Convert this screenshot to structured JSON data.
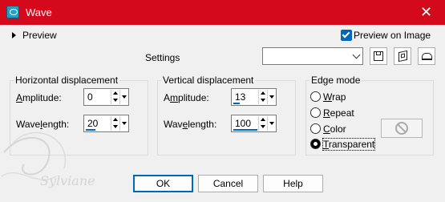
{
  "window": {
    "title": "Wave",
    "close_symbol": "✕"
  },
  "preview": {
    "toggle_label": "Preview",
    "on_image_label": "Preview on Image",
    "on_image_checked": true
  },
  "settings": {
    "label": "Settings",
    "selected": "",
    "buttons": [
      "save-preset-icon",
      "preset-library-icon",
      "reset-icon"
    ]
  },
  "horizontal": {
    "title": "Horizontal displacement",
    "amplitude_label_pre": "",
    "amplitude_label_u": "A",
    "amplitude_label_post": "mplitude:",
    "amplitude_value": "0",
    "wavelength_label_pre": "Wave",
    "wavelength_label_u": "l",
    "wavelength_label_post": "ength:",
    "wavelength_value": "20"
  },
  "vertical": {
    "title": "Vertical displacement",
    "amplitude_label_pre": "A",
    "amplitude_label_u": "m",
    "amplitude_label_post": "plitude:",
    "amplitude_value": "13",
    "wavelength_label_pre": "Wav",
    "wavelength_label_u": "e",
    "wavelength_label_post": "length:",
    "wavelength_value": "100"
  },
  "edge_mode": {
    "title": "Edge mode",
    "options": [
      {
        "pre": "",
        "u": "W",
        "post": "rap",
        "selected": false
      },
      {
        "pre": "",
        "u": "R",
        "post": "epeat",
        "selected": false
      },
      {
        "pre": "",
        "u": "C",
        "post": "olor",
        "selected": false
      },
      {
        "pre": "",
        "u": "T",
        "post": "ransparent",
        "selected": true
      }
    ],
    "color_swatch_icon": "no-color-icon"
  },
  "buttons": {
    "ok": "OK",
    "cancel": "Cancel",
    "help": "Help"
  },
  "watermark": "Sylviane"
}
